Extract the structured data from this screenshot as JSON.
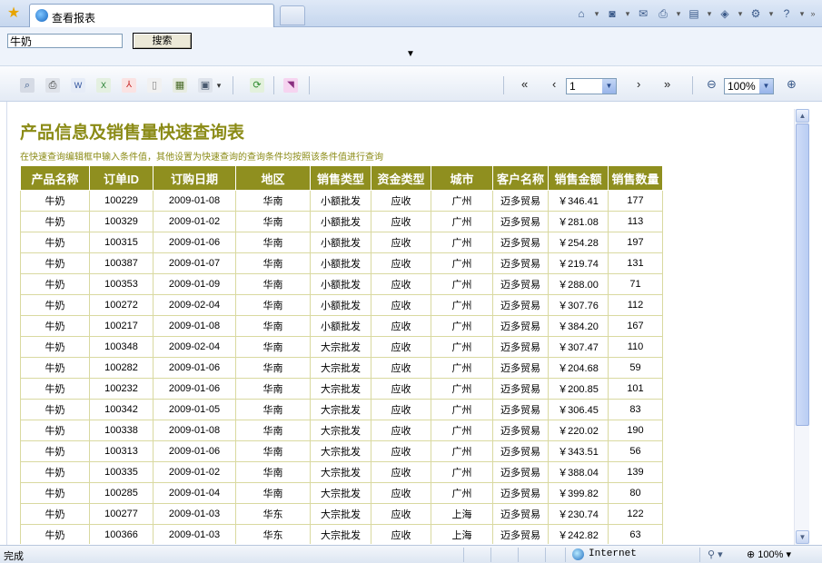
{
  "browser": {
    "tab_title": "查看报表",
    "cmd_icons": [
      "home-icon",
      "feeds-icon",
      "read-mail-icon",
      "print-icon",
      "page-icon",
      "safety-icon",
      "tools-icon",
      "help-icon"
    ]
  },
  "query": {
    "input_value": "牛奶",
    "search_label": "搜索"
  },
  "toolbar": {
    "first_label": "«",
    "prev_label": "‹",
    "page_value": "1",
    "next_label": "›",
    "last_label": "»",
    "zoom_value": "100%"
  },
  "report": {
    "title": "产品信息及销售量快速查询表",
    "subtitle": "在快速查询编辑框中输入条件值，其他设置为快速查询的查询条件均按照该条件值进行查询",
    "columns": [
      "产品名称",
      "订单ID",
      "订购日期",
      "地区",
      "销售类型",
      "资金类型",
      "城市",
      "客户名称",
      "销售金额",
      "销售数量"
    ],
    "rows": [
      [
        "牛奶",
        "100229",
        "2009-01-08",
        "华南",
        "小额批发",
        "应收",
        "广州",
        "迈多贸易",
        "￥346.41",
        "177"
      ],
      [
        "牛奶",
        "100329",
        "2009-01-02",
        "华南",
        "小额批发",
        "应收",
        "广州",
        "迈多贸易",
        "￥281.08",
        "113"
      ],
      [
        "牛奶",
        "100315",
        "2009-01-06",
        "华南",
        "小额批发",
        "应收",
        "广州",
        "迈多贸易",
        "￥254.28",
        "197"
      ],
      [
        "牛奶",
        "100387",
        "2009-01-07",
        "华南",
        "小额批发",
        "应收",
        "广州",
        "迈多贸易",
        "￥219.74",
        "131"
      ],
      [
        "牛奶",
        "100353",
        "2009-01-09",
        "华南",
        "小额批发",
        "应收",
        "广州",
        "迈多贸易",
        "￥288.00",
        "71"
      ],
      [
        "牛奶",
        "100272",
        "2009-02-04",
        "华南",
        "小额批发",
        "应收",
        "广州",
        "迈多贸易",
        "￥307.76",
        "112"
      ],
      [
        "牛奶",
        "100217",
        "2009-01-08",
        "华南",
        "小额批发",
        "应收",
        "广州",
        "迈多贸易",
        "￥384.20",
        "167"
      ],
      [
        "牛奶",
        "100348",
        "2009-02-04",
        "华南",
        "大宗批发",
        "应收",
        "广州",
        "迈多贸易",
        "￥307.47",
        "110"
      ],
      [
        "牛奶",
        "100282",
        "2009-01-06",
        "华南",
        "大宗批发",
        "应收",
        "广州",
        "迈多贸易",
        "￥204.68",
        "59"
      ],
      [
        "牛奶",
        "100232",
        "2009-01-06",
        "华南",
        "大宗批发",
        "应收",
        "广州",
        "迈多贸易",
        "￥200.85",
        "101"
      ],
      [
        "牛奶",
        "100342",
        "2009-01-05",
        "华南",
        "大宗批发",
        "应收",
        "广州",
        "迈多贸易",
        "￥306.45",
        "83"
      ],
      [
        "牛奶",
        "100338",
        "2009-01-08",
        "华南",
        "大宗批发",
        "应收",
        "广州",
        "迈多贸易",
        "￥220.02",
        "190"
      ],
      [
        "牛奶",
        "100313",
        "2009-01-06",
        "华南",
        "大宗批发",
        "应收",
        "广州",
        "迈多贸易",
        "￥343.51",
        "56"
      ],
      [
        "牛奶",
        "100335",
        "2009-01-02",
        "华南",
        "大宗批发",
        "应收",
        "广州",
        "迈多贸易",
        "￥388.04",
        "139"
      ],
      [
        "牛奶",
        "100285",
        "2009-01-04",
        "华南",
        "大宗批发",
        "应收",
        "广州",
        "迈多贸易",
        "￥399.82",
        "80"
      ],
      [
        "牛奶",
        "100277",
        "2009-01-03",
        "华东",
        "大宗批发",
        "应收",
        "上海",
        "迈多贸易",
        "￥230.74",
        "122"
      ],
      [
        "牛奶",
        "100366",
        "2009-01-03",
        "华东",
        "大宗批发",
        "应收",
        "上海",
        "迈多贸易",
        "￥242.82",
        "63"
      ]
    ]
  },
  "status": {
    "text": "完成",
    "zone": "Internet",
    "zoom": "100%"
  },
  "colors": {
    "header_bg": "#8f8f1f",
    "title": "#8b8b16"
  }
}
